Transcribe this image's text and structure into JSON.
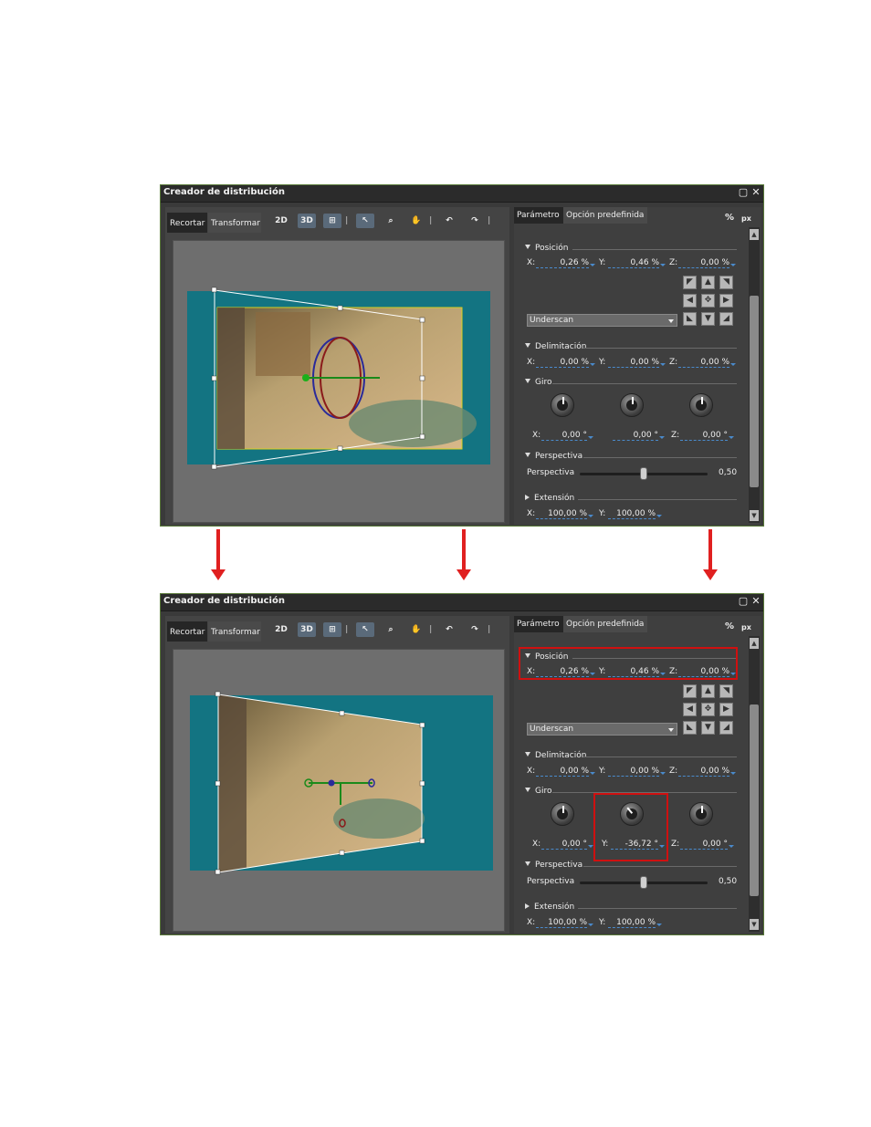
{
  "window": {
    "title": "Creador de distribución"
  },
  "left_tabs": [
    "Recortar",
    "Transformar"
  ],
  "toolbar": {
    "btn_2d": "2D",
    "btn_3d": "3D"
  },
  "right_tabs": [
    "Parámetro",
    "Opción predefinida"
  ],
  "units": {
    "percent": "%",
    "px": "px"
  },
  "sections": {
    "posicion": "Posición",
    "delimitacion": "Delimitación",
    "giro": "Giro",
    "perspectiva": "Perspectiva",
    "extension": "Extensión"
  },
  "axis": {
    "x": "X:",
    "y": "Y:",
    "z": "Z:"
  },
  "dropdown": {
    "underscan": "Underscan"
  },
  "perspectiva_label": "Perspectiva",
  "before": {
    "posicion": {
      "x": "0,26 %",
      "y": "0,46 %",
      "z": "0,00 %"
    },
    "delimitacion": {
      "x": "0,00 %",
      "y": "0,00 %",
      "z": "0,00 %"
    },
    "giro": {
      "x": "0,00 °",
      "y": "0,00 °",
      "z": "0,00 °"
    },
    "perspectiva": "0,50",
    "extension": {
      "x": "100,00 %",
      "y": "100,00 %"
    }
  },
  "after": {
    "posicion": {
      "x": "0,26 %",
      "y": "0,46 %",
      "z": "0,00 %"
    },
    "delimitacion": {
      "x": "0,00 %",
      "y": "0,00 %",
      "z": "0,00 %"
    },
    "giro": {
      "x": "0,00 °",
      "y": "-36,72 °",
      "z": "0,00 °"
    },
    "perspectiva": "0,50",
    "extension": {
      "x": "100,00 %",
      "y": "100,00 %"
    }
  },
  "colors": {
    "highlight": "#d01010",
    "arrow": "#e02020",
    "teal": "#137482"
  },
  "icons": [
    "2d-icon",
    "3d-icon",
    "grid-icon",
    "pointer-icon",
    "zoom-icon",
    "hand-icon",
    "undo-icon",
    "redo-icon"
  ]
}
